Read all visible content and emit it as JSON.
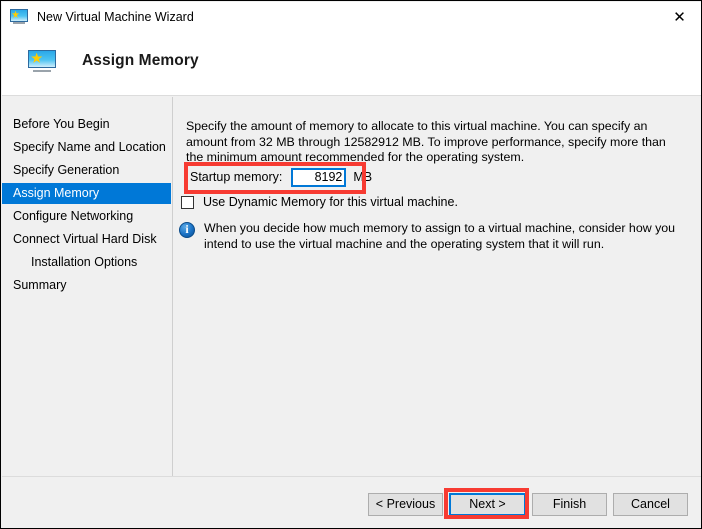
{
  "window": {
    "title": "New Virtual Machine Wizard",
    "icon": "virtual-machine-monitor-icon",
    "close_label": "✕"
  },
  "header": {
    "title": "Assign Memory",
    "icon": "virtual-machine-monitor-icon"
  },
  "sidebar": {
    "items": [
      {
        "label": "Before You Begin",
        "selected": false,
        "indent": false
      },
      {
        "label": "Specify Name and Location",
        "selected": false,
        "indent": false
      },
      {
        "label": "Specify Generation",
        "selected": false,
        "indent": false
      },
      {
        "label": "Assign Memory",
        "selected": true,
        "indent": false
      },
      {
        "label": "Configure Networking",
        "selected": false,
        "indent": false
      },
      {
        "label": "Connect Virtual Hard Disk",
        "selected": false,
        "indent": false
      },
      {
        "label": "Installation Options",
        "selected": false,
        "indent": true
      },
      {
        "label": "Summary",
        "selected": false,
        "indent": false
      }
    ]
  },
  "main": {
    "description": "Specify the amount of memory to allocate to this virtual machine. You can specify an amount from 32 MB through 12582912 MB. To improve performance, specify more than the minimum amount recommended for the operating system.",
    "memory": {
      "label": "Startup memory:",
      "value": "8192",
      "placeholder": "",
      "unit": "MB"
    },
    "dynamic_memory": {
      "label": "Use Dynamic Memory for this virtual machine.",
      "checked": false
    },
    "note": {
      "icon": "info-icon",
      "text": "When you decide how much memory to assign to a virtual machine, consider how you intend to use the virtual machine and the operating system that it will run."
    }
  },
  "footer": {
    "previous_label": "< Previous",
    "next_label": "Next >",
    "finish_label": "Finish",
    "cancel_label": "Cancel"
  },
  "annotations": {
    "color": "#f73b32",
    "boxes": [
      {
        "target": "startup-memory-row"
      },
      {
        "target": "next-button"
      }
    ]
  },
  "colors": {
    "accent": "#0078d7",
    "sidebar_bg": "#f0f0f0",
    "annotation": "#f73b32"
  }
}
